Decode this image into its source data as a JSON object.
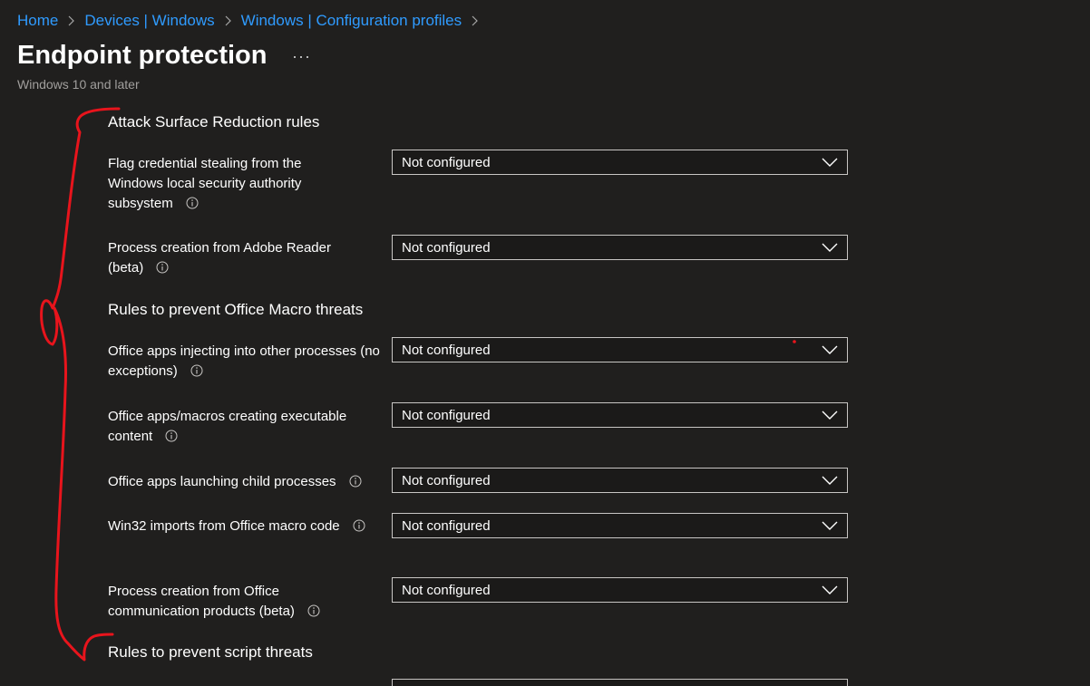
{
  "breadcrumb": {
    "items": [
      "Home",
      "Devices | Windows",
      "Windows | Configuration profiles"
    ]
  },
  "header": {
    "title": "Endpoint protection",
    "more_label": "···",
    "subtitle": "Windows 10 and later"
  },
  "sections": {
    "asr_heading": "Attack Surface Reduction rules",
    "macro_heading": "Rules to prevent Office Macro threats",
    "script_heading": "Rules to prevent script threats"
  },
  "settings": [
    {
      "label": "Flag credential stealing from the Windows local security authority subsystem",
      "value": "Not configured"
    },
    {
      "label": "Process creation from Adobe Reader (beta)",
      "value": "Not configured"
    },
    {
      "label": "Office apps injecting into other processes (no exceptions)",
      "value": "Not configured"
    },
    {
      "label": "Office apps/macros creating executable content",
      "value": "Not configured"
    },
    {
      "label": "Office apps launching child processes",
      "value": "Not configured"
    },
    {
      "label": "Win32 imports from Office macro code",
      "value": "Not configured"
    },
    {
      "label": "Process creation from Office communication products (beta)",
      "value": "Not configured"
    }
  ],
  "colors": {
    "background": "#201f1e",
    "link": "#2f9bff",
    "annotation": "#e8141c"
  },
  "icons": {
    "info": "info-circle-icon",
    "chevron": "chevron-down-icon",
    "separator": "chevron-right-icon"
  }
}
